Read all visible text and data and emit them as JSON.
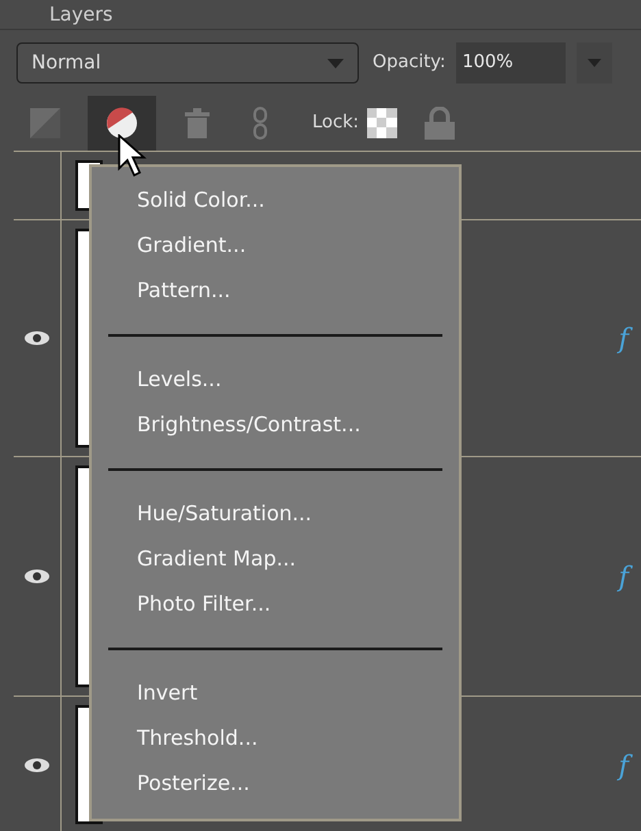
{
  "panel": {
    "title": "Layers"
  },
  "blend_mode": {
    "value": "Normal"
  },
  "opacity": {
    "label": "Opacity:",
    "value": "100%"
  },
  "toolbar": {
    "lock_label": "Lock:"
  },
  "layers": [
    {
      "visible": false
    },
    {
      "visible": true,
      "fx": "f"
    },
    {
      "visible": true,
      "fx": "f"
    },
    {
      "visible": true,
      "fx": "f"
    }
  ],
  "menu": {
    "items": [
      {
        "kind": "item",
        "label": "Solid Color..."
      },
      {
        "kind": "item",
        "label": "Gradient..."
      },
      {
        "kind": "item",
        "label": "Pattern..."
      },
      {
        "kind": "separator"
      },
      {
        "kind": "item",
        "label": "Levels..."
      },
      {
        "kind": "item",
        "label": "Brightness/Contrast..."
      },
      {
        "kind": "separator"
      },
      {
        "kind": "item",
        "label": "Hue/Saturation..."
      },
      {
        "kind": "item",
        "label": "Gradient Map..."
      },
      {
        "kind": "item",
        "label": "Photo Filter..."
      },
      {
        "kind": "separator"
      },
      {
        "kind": "item",
        "label": "Invert"
      },
      {
        "kind": "item",
        "label": "Threshold..."
      },
      {
        "kind": "item",
        "label": "Posterize..."
      }
    ]
  }
}
